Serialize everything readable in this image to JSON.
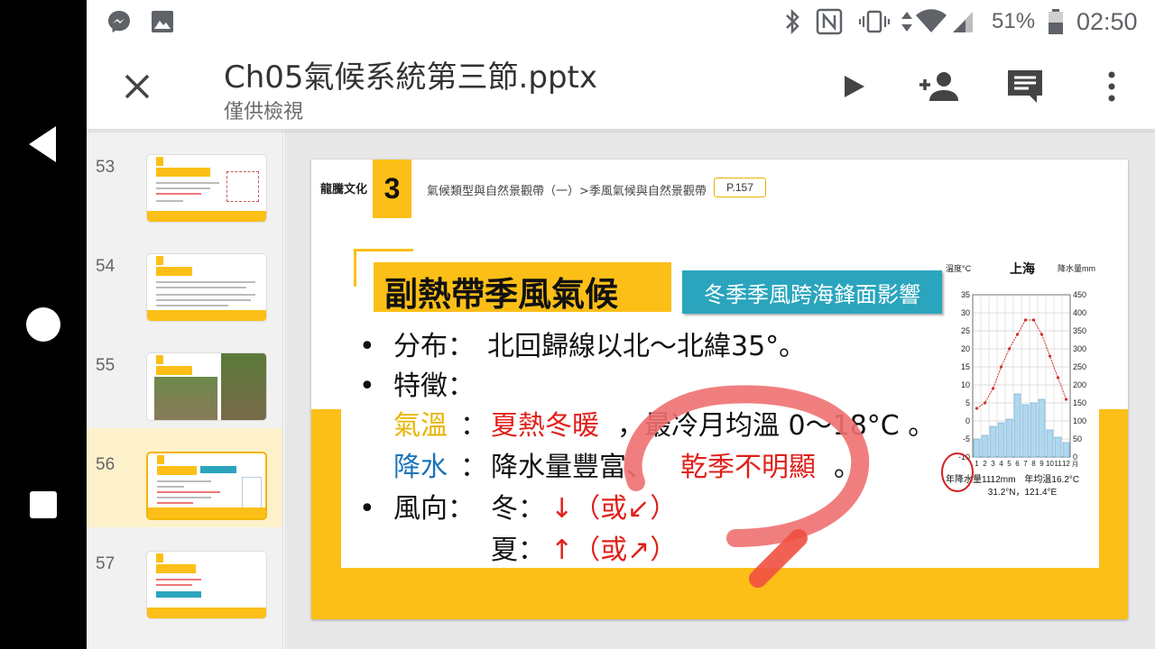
{
  "status": {
    "battery_pct": "51%",
    "time": "02:50"
  },
  "appbar": {
    "title": "Ch05氣候系統第三節.pptx",
    "subtitle": "僅供檢視"
  },
  "thumbnails": [
    {
      "num": "53",
      "title": "季風氣候與自然景觀帶"
    },
    {
      "num": "54",
      "title": "熱帶季風林"
    },
    {
      "num": "55",
      "title": "熱帶季風林"
    },
    {
      "num": "56",
      "title": "副熱帶季風氣候",
      "selected": true
    },
    {
      "num": "57",
      "title": "副熱帶季風氣候"
    }
  ],
  "slide": {
    "brand": "龍騰文化",
    "section_num": "3",
    "breadcrumb": "氣候類型與自然景觀帶（一）>季風氣候與自然景觀帶",
    "page_ref": "P.157",
    "title": "副熱帶季風氣候",
    "tag": "冬季季風跨海鋒面影響",
    "bullet": "•",
    "line1_label": "分布：",
    "line1_text": "北回歸線以北～北緯35°。",
    "line2_label": "特徵：",
    "line3_label": "氣溫",
    "colon": "：",
    "line3_red": "夏熱冬暖",
    "line3_text": "，最冷月均溫 0～18°C 。",
    "line4_label": "降水",
    "line4_text": "降水量豐富、",
    "line4_red": "乾季不明顯",
    "line4_end": "。",
    "line5_label": "風向：",
    "winter": "冬：",
    "winter_arrow": "↓（或↙）",
    "summer": "夏：",
    "summer_arrow": "↑（或↗）"
  },
  "chart_data": {
    "type": "bar",
    "title": "上海",
    "ylabel_left": "溫度°C",
    "ylabel_right": "降水量mm",
    "categories": [
      "1",
      "2",
      "3",
      "4",
      "5",
      "6",
      "7",
      "8",
      "9",
      "10",
      "11",
      "12"
    ],
    "x_unit": "月",
    "series": [
      {
        "name": "降水量",
        "kind": "bar",
        "axis": "right",
        "values": [
          50,
          60,
          85,
          95,
          105,
          175,
          145,
          150,
          160,
          75,
          55,
          40
        ]
      },
      {
        "name": "溫度",
        "kind": "line",
        "axis": "left",
        "values": [
          3.5,
          5,
          9,
          15,
          20,
          24,
          28,
          28,
          24,
          18,
          12,
          6
        ]
      }
    ],
    "temp_range": [
      -10,
      35
    ],
    "temp_ticks": [
      "35",
      "30",
      "25",
      "20",
      "15",
      "10",
      "5",
      "0",
      "-5",
      "-10"
    ],
    "precip_range": [
      0,
      450
    ],
    "precip_ticks": [
      "450",
      "400",
      "350",
      "300",
      "250",
      "200",
      "150",
      "100",
      "50",
      "0"
    ],
    "footer1": "年降水量1112mm　年均溫16.2°C",
    "footer2": "31.2°N，121.4°E"
  },
  "colors": {
    "accent_yellow": "#fbbf17",
    "tag_teal": "#2aa5bd",
    "highlight_red": "#e0201a",
    "selected_row": "#fdf1cc"
  }
}
